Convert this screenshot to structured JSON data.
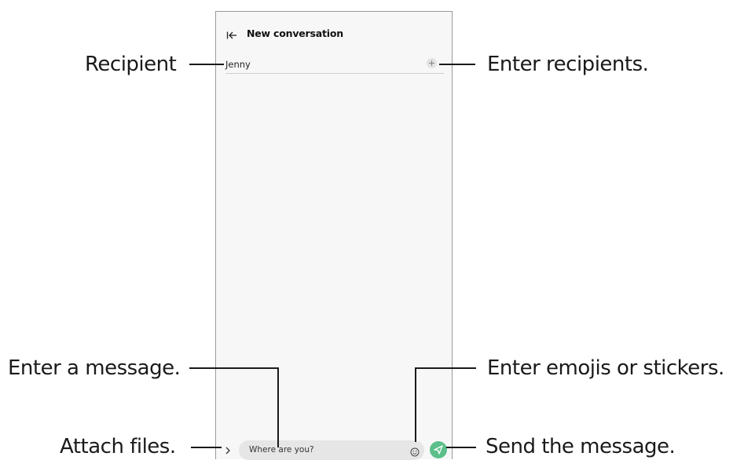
{
  "screen": {
    "title": "New conversation",
    "back_icon": "collapse-back-icon",
    "recipient": {
      "name": "Jenny",
      "add_icon": "plus-icon"
    },
    "composer": {
      "message_text": "Where are you?",
      "attach_icon": "chevron-right-icon",
      "emoji_icon": "smiley-icon",
      "send_icon": "send-icon",
      "send_color": "#5cbf89"
    }
  },
  "callouts": {
    "recipient": "Recipient",
    "enter_recipients": "Enter recipients.",
    "enter_message": "Enter a message.",
    "enter_emojis": "Enter emojis or stickers.",
    "attach_files": "Attach files.",
    "send_message": "Send the message."
  }
}
